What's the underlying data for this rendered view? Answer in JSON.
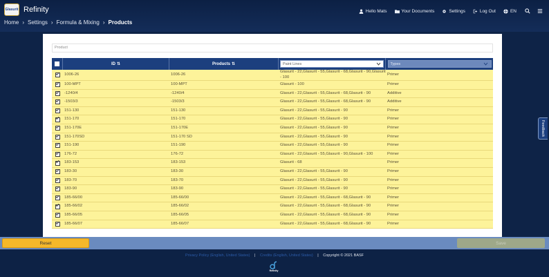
{
  "header": {
    "app_title": "Refinity",
    "logo_text": "Glasurit",
    "nav": {
      "hello": "Hello Mats",
      "documents": "Your Documents",
      "settings": "Settings",
      "logout": "Log Out",
      "language": "EN"
    }
  },
  "breadcrumb": [
    "Home",
    "Settings",
    "Formula & Mixing",
    "Products"
  ],
  "search": {
    "placeholder": "Product"
  },
  "table": {
    "headers": {
      "id": "ID",
      "products": "Products"
    },
    "paint_lines_select": "Paint Lines",
    "types_select": "Types",
    "rows": [
      {
        "id": "1006-26",
        "product": "1006-26",
        "lines": "Glasurit - 22,Glasurit - 55,Glasurit - 68,Glasurit - 90,Glasurit - 100",
        "type": "Primer"
      },
      {
        "id": "100-MPT",
        "product": "100-MPT",
        "lines": "Glasurit - 100",
        "type": "Primer"
      },
      {
        "id": "-1240/4",
        "product": "-1240/4",
        "lines": "Glasurit - 22,Glasurit - 55,Glasurit - 68,Glasurit - 90",
        "type": "Additive"
      },
      {
        "id": "-1503/3",
        "product": "-1503/3",
        "lines": "Glasurit - 22,Glasurit - 55,Glasurit - 68,Glasurit - 90",
        "type": "Additive"
      },
      {
        "id": "151-130",
        "product": "151-130",
        "lines": "Glasurit - 22,Glasurit - 55,Glasurit - 90",
        "type": "Primer"
      },
      {
        "id": "151-170",
        "product": "151-170",
        "lines": "Glasurit - 22,Glasurit - 55,Glasurit - 90",
        "type": "Primer"
      },
      {
        "id": "151-170E",
        "product": "151-170E",
        "lines": "Glasurit - 22,Glasurit - 55,Glasurit - 90",
        "type": "Primer"
      },
      {
        "id": "151-170SD",
        "product": "151-170 SD",
        "lines": "Glasurit - 22,Glasurit - 55,Glasurit - 90",
        "type": "Primer"
      },
      {
        "id": "151-190",
        "product": "151-190",
        "lines": "Glasurit - 22,Glasurit - 55,Glasurit - 90",
        "type": "Primer"
      },
      {
        "id": "176-72",
        "product": "176-72",
        "lines": "Glasurit - 22,Glasurit - 55,Glasurit - 90,Glasurit - 100",
        "type": "Primer"
      },
      {
        "id": "183-153",
        "product": "183-153",
        "lines": "Glasurit - 68",
        "type": "Primer"
      },
      {
        "id": "183-30",
        "product": "183-30",
        "lines": "Glasurit - 22,Glasurit - 55,Glasurit - 90",
        "type": "Primer"
      },
      {
        "id": "183-70",
        "product": "183-70",
        "lines": "Glasurit - 22,Glasurit - 55,Glasurit - 90",
        "type": "Primer"
      },
      {
        "id": "183-90",
        "product": "183-90",
        "lines": "Glasurit - 22,Glasurit - 55,Glasurit - 90",
        "type": "Primer"
      },
      {
        "id": "185-66/00",
        "product": "185-66/00",
        "lines": "Glasurit - 22,Glasurit - 55,Glasurit - 68,Glasurit - 90",
        "type": "Primer"
      },
      {
        "id": "185-66/02",
        "product": "185-66/02",
        "lines": "Glasurit - 22,Glasurit - 55,Glasurit - 68,Glasurit - 90",
        "type": "Primer"
      },
      {
        "id": "185-66/05",
        "product": "185-66/05",
        "lines": "Glasurit - 22,Glasurit - 55,Glasurit - 68,Glasurit - 90",
        "type": "Primer"
      },
      {
        "id": "185-66/07",
        "product": "185-66/07",
        "lines": "Glasurit - 22,Glasurit - 55,Glasurit - 68,Glasurit - 90",
        "type": "Primer"
      }
    ]
  },
  "actions": {
    "reset": "Reset",
    "save": "Save"
  },
  "footer": {
    "privacy": "Privacy Policy (English, United States)",
    "credits": "Credits (English, United States)",
    "copyright": "Copyright © 2021 BASF",
    "logo_text": "Refinity"
  },
  "feedback": "Feedback",
  "colors": {
    "row_bg": "#fdf39a",
    "header_bg": "#1c3f7e",
    "reset_btn": "#f5b82a",
    "bar_bg": "#6a8bbf"
  }
}
